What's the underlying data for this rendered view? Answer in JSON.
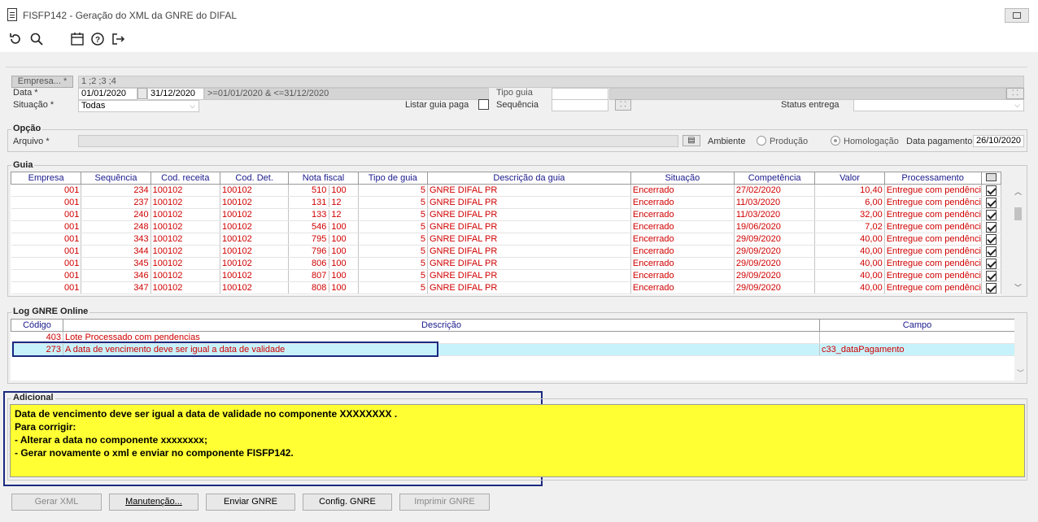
{
  "window": {
    "title": "FISFP142 - Geração do XML da GNRE do DIFAL"
  },
  "toolbar": {
    "icons": [
      "refresh-icon",
      "search-icon",
      "calendar-icon",
      "help-icon",
      "exit-icon"
    ]
  },
  "filters": {
    "empresa_label": "Empresa... *",
    "empresa_value": "1 ;2 ;3 ;4",
    "data_label": "Data *",
    "data_inicio": "01/01/2020",
    "data_fim": "31/12/2020",
    "data_expr": ">=01/01/2020 & <=31/12/2020",
    "tipo_guia_label": "Tipo guia",
    "tipo_guia_value": "",
    "situacao_label": "Situação *",
    "situacao_value": "Todas",
    "listar_guia_label": "Listar guia paga",
    "sequencia_label": "Sequência",
    "sequencia_value": "",
    "status_entrega_label": "Status entrega",
    "status_entrega_value": ""
  },
  "opcao": {
    "title": "Opção",
    "arquivo_label": "Arquivo *",
    "arquivo_value": "",
    "ambiente_label": "Ambiente",
    "producao_label": "Produção",
    "homologacao_label": "Homologação",
    "data_pagamento_label": "Data pagamento",
    "data_pagamento_value": "26/10/2020"
  },
  "guia": {
    "title": "Guia",
    "columns": [
      "Empresa",
      "Sequência",
      "Cod. receita",
      "Cod. Det.",
      "Nota fiscal",
      "Tipo de guia",
      "Descrição da guia",
      "Situação",
      "Competência",
      "Valor",
      "Processamento"
    ],
    "rows": [
      {
        "empresa": "001",
        "sequencia": "234",
        "cod_receita": "100102",
        "cod_det": "100102",
        "nota": "510",
        "serie": "100",
        "tipo": "5",
        "descricao": "GNRE DIFAL PR",
        "situacao": "Encerrado",
        "competencia": "27/02/2020",
        "valor": "10,40",
        "processamento": "Entregue com pendênci",
        "checked": true
      },
      {
        "empresa": "001",
        "sequencia": "237",
        "cod_receita": "100102",
        "cod_det": "100102",
        "nota": "131",
        "serie": "12",
        "tipo": "5",
        "descricao": "GNRE DIFAL PR",
        "situacao": "Encerrado",
        "competencia": "11/03/2020",
        "valor": "6,00",
        "processamento": "Entregue com pendênci",
        "checked": true
      },
      {
        "empresa": "001",
        "sequencia": "240",
        "cod_receita": "100102",
        "cod_det": "100102",
        "nota": "133",
        "serie": "12",
        "tipo": "5",
        "descricao": "GNRE DIFAL PR",
        "situacao": "Encerrado",
        "competencia": "11/03/2020",
        "valor": "32,00",
        "processamento": "Entregue com pendênci",
        "checked": true
      },
      {
        "empresa": "001",
        "sequencia": "248",
        "cod_receita": "100102",
        "cod_det": "100102",
        "nota": "546",
        "serie": "100",
        "tipo": "5",
        "descricao": "GNRE DIFAL PR",
        "situacao": "Encerrado",
        "competencia": "19/06/2020",
        "valor": "7,02",
        "processamento": "Entregue com pendênci",
        "checked": true
      },
      {
        "empresa": "001",
        "sequencia": "343",
        "cod_receita": "100102",
        "cod_det": "100102",
        "nota": "795",
        "serie": "100",
        "tipo": "5",
        "descricao": "GNRE DIFAL PR",
        "situacao": "Encerrado",
        "competencia": "29/09/2020",
        "valor": "40,00",
        "processamento": "Entregue com pendênci",
        "checked": true
      },
      {
        "empresa": "001",
        "sequencia": "344",
        "cod_receita": "100102",
        "cod_det": "100102",
        "nota": "796",
        "serie": "100",
        "tipo": "5",
        "descricao": "GNRE DIFAL PR",
        "situacao": "Encerrado",
        "competencia": "29/09/2020",
        "valor": "40,00",
        "processamento": "Entregue com pendênci",
        "checked": true
      },
      {
        "empresa": "001",
        "sequencia": "345",
        "cod_receita": "100102",
        "cod_det": "100102",
        "nota": "806",
        "serie": "100",
        "tipo": "5",
        "descricao": "GNRE DIFAL PR",
        "situacao": "Encerrado",
        "competencia": "29/09/2020",
        "valor": "40,00",
        "processamento": "Entregue com pendênci",
        "checked": true
      },
      {
        "empresa": "001",
        "sequencia": "346",
        "cod_receita": "100102",
        "cod_det": "100102",
        "nota": "807",
        "serie": "100",
        "tipo": "5",
        "descricao": "GNRE DIFAL PR",
        "situacao": "Encerrado",
        "competencia": "29/09/2020",
        "valor": "40,00",
        "processamento": "Entregue com pendênci",
        "checked": true
      },
      {
        "empresa": "001",
        "sequencia": "347",
        "cod_receita": "100102",
        "cod_det": "100102",
        "nota": "808",
        "serie": "100",
        "tipo": "5",
        "descricao": "GNRE DIFAL PR",
        "situacao": "Encerrado",
        "competencia": "29/09/2020",
        "valor": "40,00",
        "processamento": "Entregue com pendênci",
        "checked": true
      }
    ]
  },
  "log": {
    "title": "Log GNRE Online",
    "columns": [
      "Código",
      "Descrição",
      "Campo"
    ],
    "rows": [
      {
        "codigo": "403",
        "descricao": "Lote Processado com pendencias",
        "campo": ""
      },
      {
        "codigo": "273",
        "descricao": "A data de vencimento deve ser igual a data de validade",
        "campo": "c33_dataPagamento"
      }
    ]
  },
  "adicional": {
    "title": "Adicional",
    "lines": [
      "Data de vencimento deve ser igual a data de validade no componente XXXXXXXX .",
      "Para corrigir:",
      "- Alterar a data no componente xxxxxxxx;",
      "- Gerar novamente o xml e enviar no componente FISFP142."
    ]
  },
  "buttons": {
    "gerar_xml": "Gerar XML",
    "manutencao": "Manutenção...",
    "enviar_gnre": "Enviar GNRE",
    "config_gnre": "Config. GNRE",
    "imprimir_gnre": "Imprimir GNRE"
  }
}
